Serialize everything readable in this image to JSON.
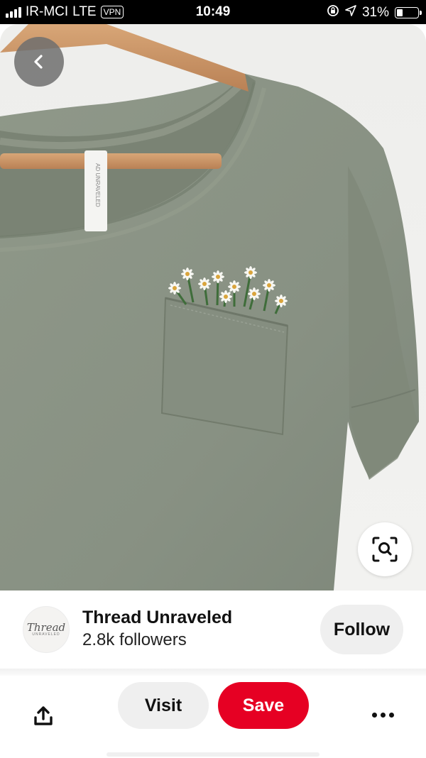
{
  "status_bar": {
    "carrier": "IR-MCI",
    "network": "LTE",
    "vpn": "VPN",
    "time": "10:49",
    "battery_percent": "31%",
    "battery_level": 0.31
  },
  "pin": {
    "image_alt": "Sage green t-shirt on a wooden hanger with embroidered daisies peeking out of the chest pocket",
    "label_text": "AD UNRAVELED",
    "icons": {
      "back": "chevron-left-icon",
      "lens": "visual-search-icon"
    }
  },
  "creator": {
    "name": "Thread Unraveled",
    "followers": "2.8k followers",
    "avatar_script": "Thread",
    "avatar_sub": "UNRAVELED",
    "follow_label": "Follow"
  },
  "actions": {
    "visit_label": "Visit",
    "save_label": "Save",
    "icons": {
      "share": "share-icon",
      "more": "more-icon"
    }
  },
  "colors": {
    "save": "#e60023",
    "pill": "#efefef",
    "shirt": "#8b9485"
  }
}
